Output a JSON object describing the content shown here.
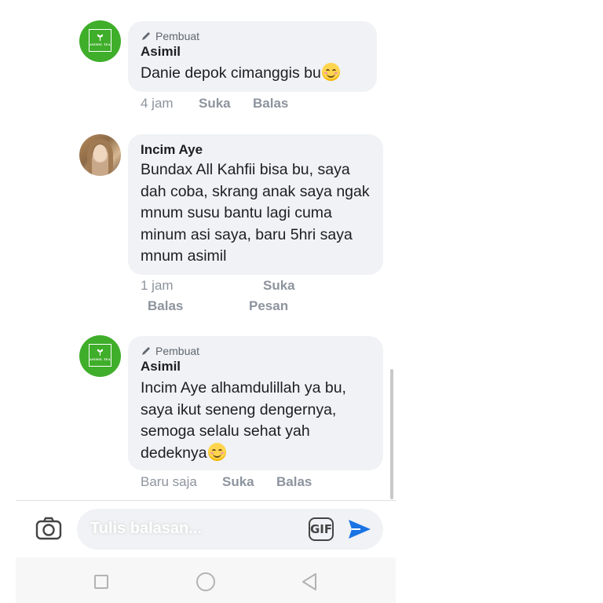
{
  "comments": [
    {
      "role": "Pembuat",
      "author": "Asimil",
      "text": "Danie depok cimanggis bu",
      "time": "4 jam",
      "like": "Suka",
      "reply": "Balas",
      "avatar_text": "ASIMIL TEA"
    },
    {
      "author": "Incim Aye",
      "text": "Bundax All Kahfii bisa bu, saya dah coba, skrang anak saya ngak mnum susu bantu lagi cuma minum asi saya, baru 5hri saya mnum asimil",
      "time": "1 jam",
      "like": "Suka",
      "reply": "Balas",
      "message": "Pesan"
    },
    {
      "role": "Pembuat",
      "author": "Asimil",
      "text": "Incim Aye alhamdulillah ya bu, saya ikut seneng dengernya, semoga selalu sehat yah dedeknya",
      "time": "Baru saja",
      "like": "Suka",
      "reply": "Balas",
      "avatar_text": "ASIMIL TEA"
    }
  ],
  "composer": {
    "input_value": "Tulis balasan...",
    "gif_label": "GIF"
  },
  "icons": {
    "camera": "camera-icon",
    "send": "send-icon",
    "pen": "pen-icon",
    "emoji": "smiling-face-emoji",
    "leaf": "leaf-icon",
    "nav_recent": "square-icon",
    "nav_home": "circle-icon",
    "nav_back": "triangle-back-icon"
  },
  "colors": {
    "brand_green": "#3fae2a",
    "bubble_bg": "#f0f2f5",
    "send_blue": "#1b74e4",
    "meta_gray": "#8d949e"
  }
}
